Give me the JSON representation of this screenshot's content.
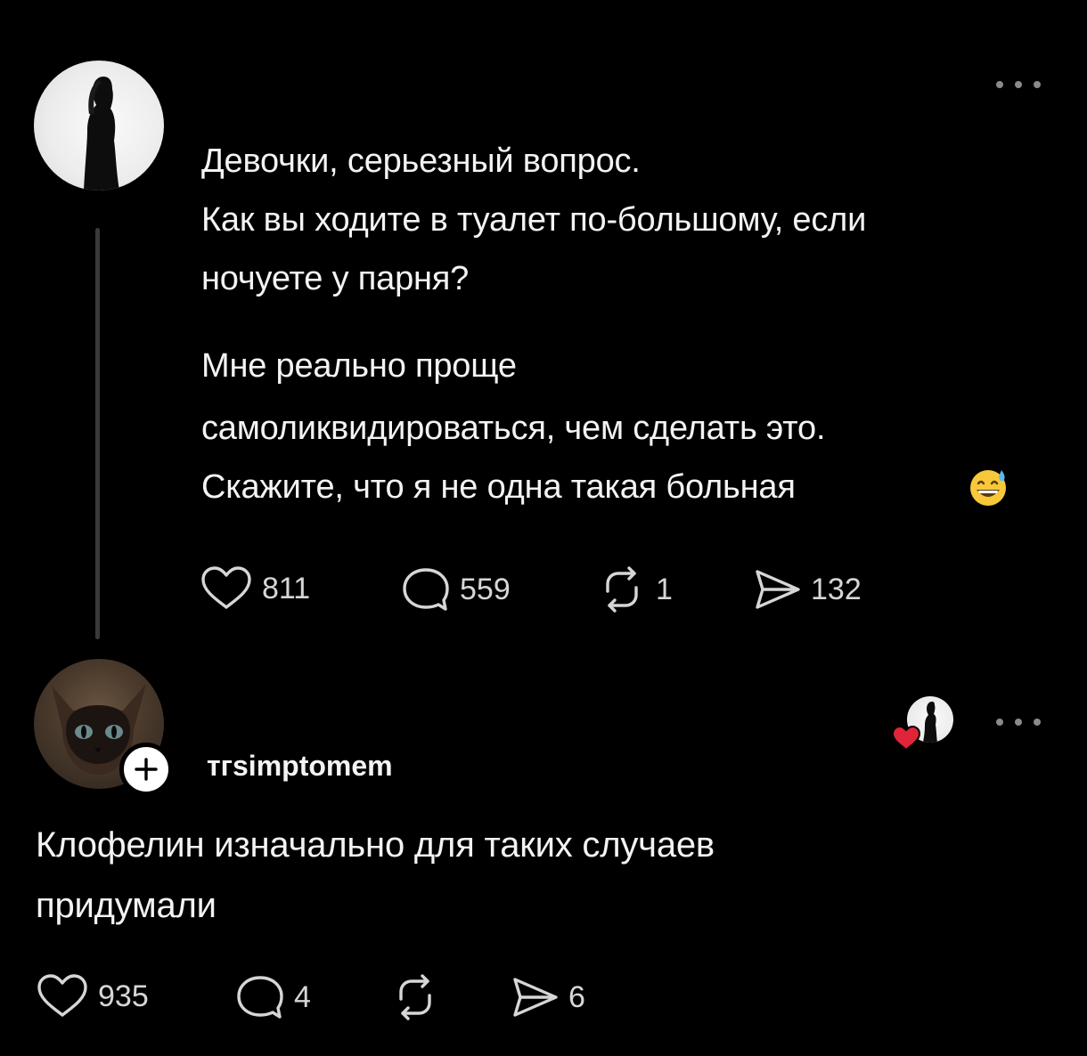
{
  "post": {
    "lines": [
      "Девочки, серьезный вопрос.",
      "Как вы ходите в туалет по-большому, если",
      "ночуете у парня?",
      "Мне реально проще",
      "самоликвидироваться, чем сделать это.",
      "Скажите, что я не одна такая больная"
    ],
    "emoji": "grinning-face-with-sweat-icon",
    "stats": {
      "likes": "811",
      "comments": "559",
      "reposts": "1",
      "shares": "132"
    }
  },
  "reply": {
    "username": "тгsimptomem",
    "lines": [
      "Клофелин изначально для таких случаев",
      "придумали"
    ],
    "stats": {
      "likes": "935",
      "comments": "4",
      "reposts": "",
      "shares": "6"
    }
  },
  "colors": {
    "background": "#000000",
    "text": "#f3f3f3",
    "icon": "#d6d6d6",
    "thread_line": "#3a3a3a",
    "heart": "#e0243a"
  }
}
